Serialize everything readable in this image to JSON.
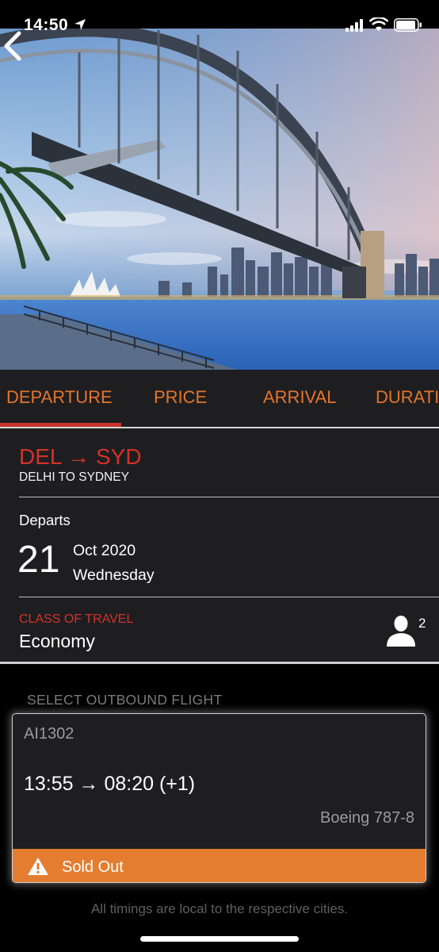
{
  "status_bar": {
    "time": "14:50"
  },
  "tabs": [
    {
      "label": "DEPARTURE"
    },
    {
      "label": "PRICE"
    },
    {
      "label": "ARRIVAL"
    },
    {
      "label": "DURATI"
    }
  ],
  "route": {
    "codes": "DEL → SYD",
    "cities": "DELHI TO SYDNEY"
  },
  "departure": {
    "label": "Departs",
    "day": "21",
    "month_year": "Oct 2020",
    "weekday": "Wednesday"
  },
  "travel_class": {
    "label": "CLASS OF TRAVEL",
    "value": "Economy",
    "passengers": "2"
  },
  "section": {
    "label": "SELECT OUTBOUND FLIGHT"
  },
  "flight": {
    "number": "AI1302",
    "times": "13:55 → 08:20 (+1)",
    "aircraft": "Boeing 787-8",
    "status": "Sold Out"
  },
  "footnote": "All timings are local to the respective cities.",
  "colors": {
    "accent_red": "#d2322b",
    "accent_orange": "#e3752a",
    "sold_out_bg": "#e47d30",
    "panel": "#1e1e20"
  }
}
